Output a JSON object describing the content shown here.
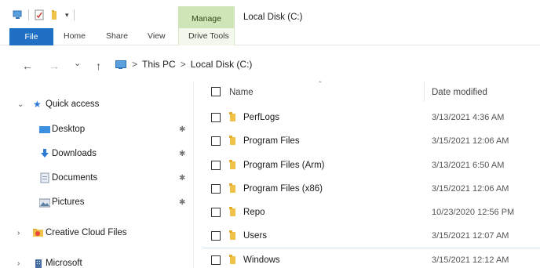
{
  "window": {
    "title": "Local Disk (C:)"
  },
  "ribbon": {
    "context_group": "Manage",
    "tabs": [
      "File",
      "Home",
      "Share",
      "View",
      "Drive Tools"
    ]
  },
  "qat": {
    "dropdown_glyph": "▾"
  },
  "address": {
    "back": "←",
    "forward": "→",
    "recent": "⌄",
    "up": "↑",
    "path": [
      "This PC",
      "Local Disk (C:)"
    ],
    "separator": ">"
  },
  "nav_pane": {
    "quick_access": "Quick access",
    "items": [
      {
        "label": "Desktop",
        "icon": "desktop-icon",
        "pinned": true
      },
      {
        "label": "Downloads",
        "icon": "downloads-icon",
        "pinned": true
      },
      {
        "label": "Documents",
        "icon": "documents-icon",
        "pinned": true
      },
      {
        "label": "Pictures",
        "icon": "pictures-icon",
        "pinned": true
      }
    ],
    "roots": [
      {
        "label": "Creative Cloud Files",
        "icon": "creative-cloud-folder-icon"
      },
      {
        "label": "Microsoft",
        "icon": "building-icon"
      }
    ],
    "pin_glyph": "✱",
    "expand_glyph": "›",
    "expanded_glyph": "⌄",
    "star_glyph": "★"
  },
  "file_list": {
    "columns": {
      "name": "Name",
      "date": "Date modified"
    },
    "sort_caret": "⌃",
    "rows": [
      {
        "name": "PerfLogs",
        "date": "3/13/2021 4:36 AM"
      },
      {
        "name": "Program Files",
        "date": "3/15/2021 12:06 AM"
      },
      {
        "name": "Program Files (Arm)",
        "date": "3/13/2021 6:50 AM"
      },
      {
        "name": "Program Files (x86)",
        "date": "3/15/2021 12:06 AM"
      },
      {
        "name": "Repo",
        "date": "10/23/2020 12:56 PM"
      },
      {
        "name": "Users",
        "date": "3/15/2021 12:07 AM"
      },
      {
        "name": "Windows",
        "date": "3/15/2021 12:12 AM"
      }
    ]
  },
  "colors": {
    "accent": "#1f6fc5",
    "manage_tab": "#cfe5b7",
    "star": "#2e7bd6",
    "folder": "#f0c24a"
  }
}
